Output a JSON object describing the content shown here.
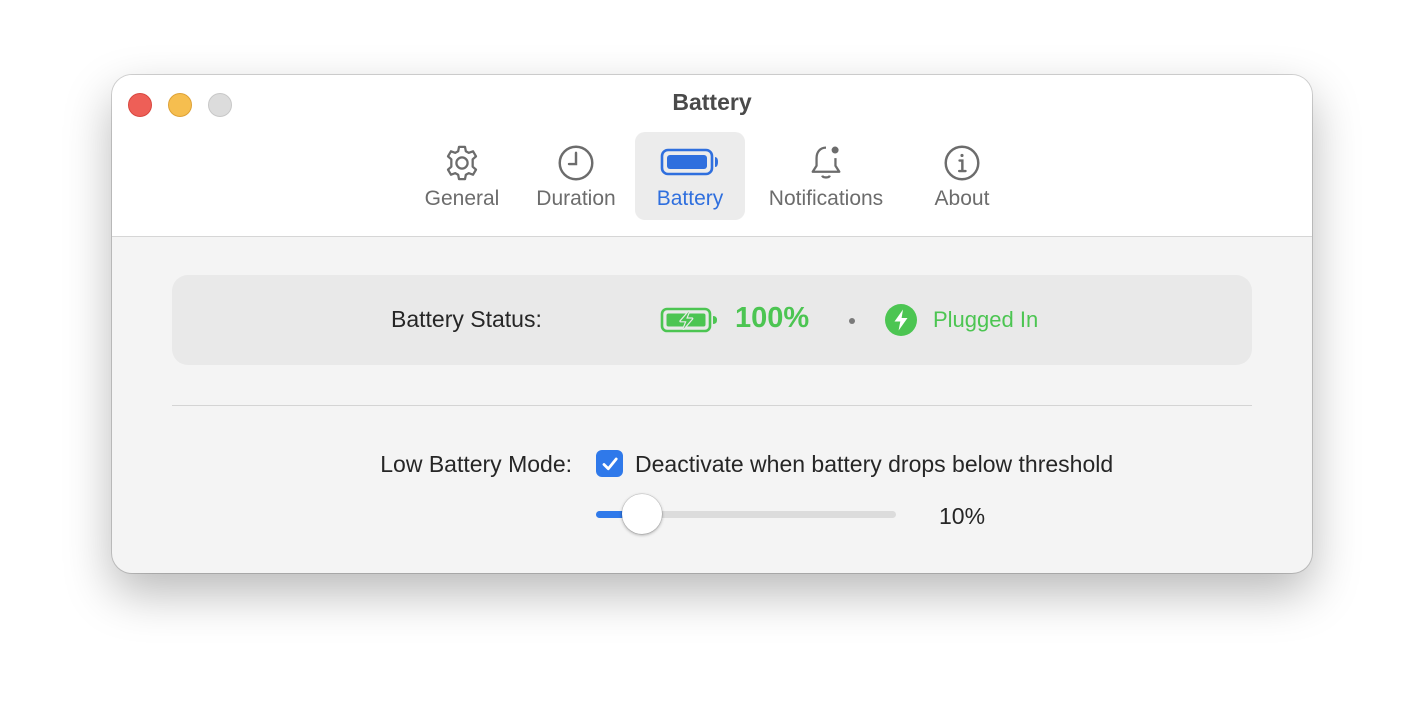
{
  "window": {
    "title": "Battery"
  },
  "tabs": [
    {
      "label": "General",
      "icon": "gear-icon",
      "active": false
    },
    {
      "label": "Duration",
      "icon": "clock-icon",
      "active": false
    },
    {
      "label": "Battery",
      "icon": "battery-icon",
      "active": true
    },
    {
      "label": "Notifications",
      "icon": "bell-badge-icon",
      "active": false
    },
    {
      "label": "About",
      "icon": "info-icon",
      "active": false
    }
  ],
  "battery_status": {
    "label": "Battery Status:",
    "percent": "100%",
    "separator": "•",
    "power_source": "Plugged In"
  },
  "low_battery": {
    "label": "Low Battery Mode:",
    "checkbox_checked": true,
    "checkbox_label": "Deactivate when battery drops below threshold",
    "threshold_value": "10%",
    "threshold_fraction": 0.1
  },
  "colors": {
    "accent": "#2f79ea",
    "active_tab_text": "#2f6fde",
    "status_green": "#4cc552",
    "close": "#ee5f57",
    "minimize": "#f6be4f",
    "zoom_disabled": "#dcdcdc"
  }
}
